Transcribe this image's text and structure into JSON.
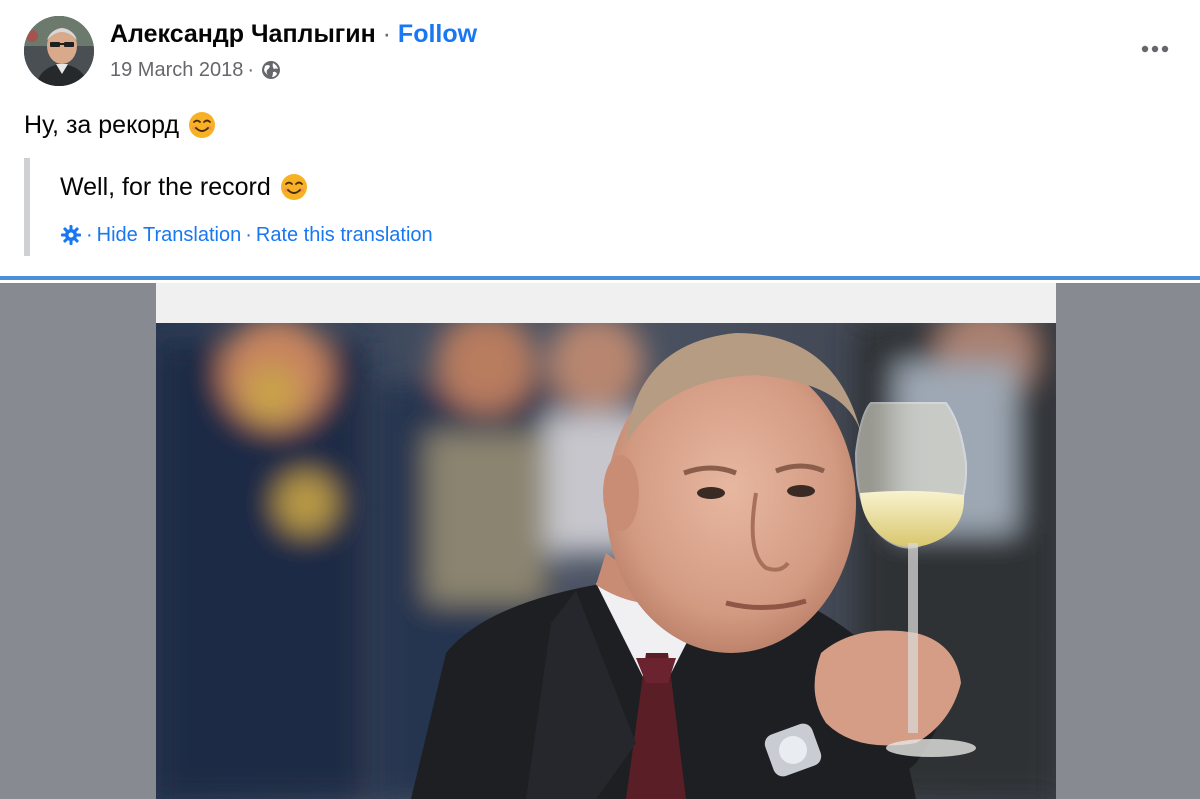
{
  "post": {
    "author": "Александр Чаплыгин",
    "separator": "·",
    "follow_label": "Follow",
    "date": "19 March 2018",
    "meta_separator": "·",
    "audience_icon": "globe-icon",
    "text": "Ну, за рекорд",
    "text_emoji": "smiling-face-emoji",
    "translation": {
      "text": "Well, for the record",
      "settings_icon": "gear-icon",
      "hide_label": "Hide Translation",
      "rate_label": "Rate this translation",
      "link_separator": "·"
    },
    "more_icon": "more-options-icon",
    "photo": "photo of a man in a dark suit raising a glass of white wine, blurred uniformed officers in background"
  },
  "colors": {
    "link": "#1877f2",
    "secondary_text": "#65676b",
    "primary_text": "#050505",
    "divider": "#4a90d9",
    "media_background": "#878a91"
  }
}
